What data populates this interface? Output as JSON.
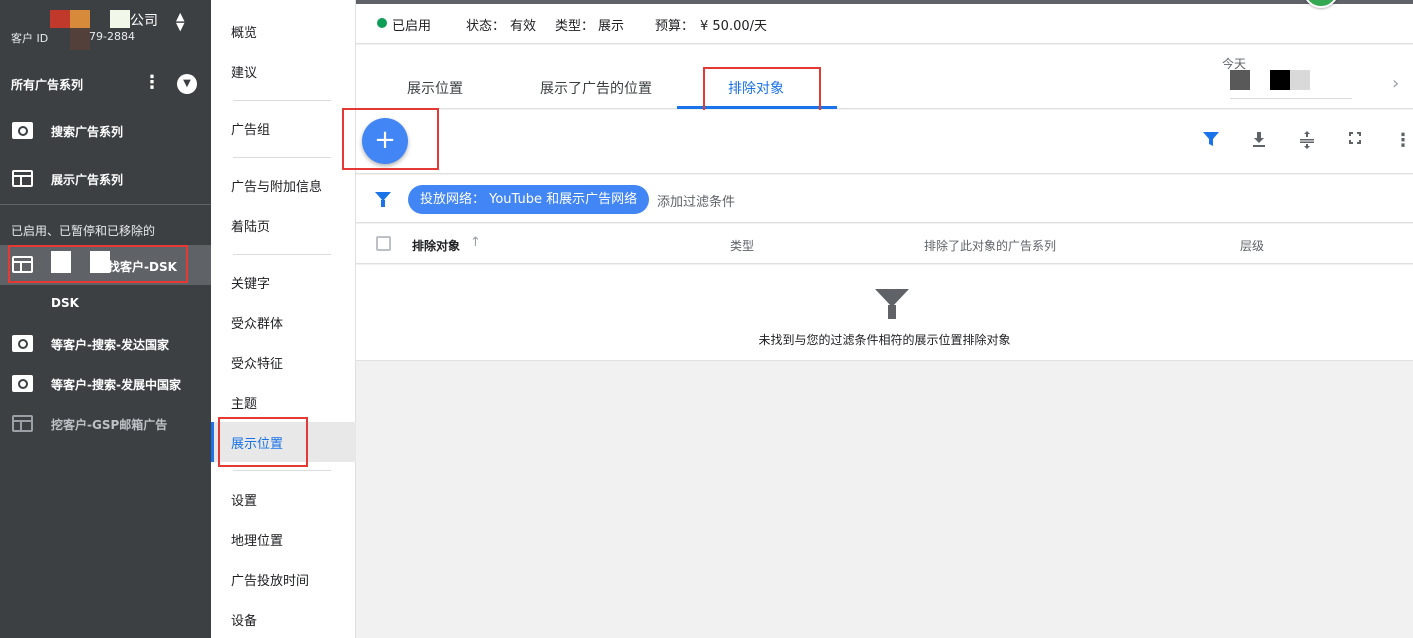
{
  "account": {
    "name_suffix": "公司",
    "customer_id_label": "客户 ID",
    "customer_id_partial": "79-2884"
  },
  "left_nav": {
    "all_campaigns": "所有广告系列",
    "search_campaigns": "搜索广告系列",
    "display_campaigns": "展示广告系列",
    "section_label": "已启用、已暂停和已移除的",
    "campaigns": [
      {
        "label": "找客户-DSK",
        "icon": "display-icon"
      },
      {
        "label": "DSK",
        "icon": ""
      },
      {
        "label": "等客户-搜索-发达国家",
        "icon": "search-icon"
      },
      {
        "label": "等客户-搜索-发展中国家",
        "icon": "search-icon"
      },
      {
        "label": "挖客户-GSP邮箱广告",
        "icon": "display-icon"
      }
    ]
  },
  "mid_nav": {
    "items": [
      "概览",
      "建议",
      "广告组",
      "广告与附加信息",
      "着陆页",
      "关键字",
      "受众群体",
      "受众特征",
      "主题",
      "展示位置",
      "设置",
      "地理位置",
      "广告投放时间",
      "设备"
    ],
    "active": "展示位置"
  },
  "status": {
    "enabled": "已启用",
    "state_label": "状态：",
    "state_value": "有效",
    "type_label": "类型：",
    "type_value": "展示",
    "budget_label": "预算：",
    "budget_value": "¥ 50.00/天"
  },
  "tabs": [
    {
      "label": "展示位置",
      "active": false
    },
    {
      "label": "展示了广告的位置",
      "active": false
    },
    {
      "label": "排除对象",
      "active": true
    }
  ],
  "date": {
    "label": "今天"
  },
  "toolbar": {
    "add": "+",
    "tools": [
      "filter-icon",
      "download-icon",
      "compact-icon",
      "fullscreen-icon",
      "more-icon"
    ]
  },
  "filter": {
    "chip": "投放网络： YouTube 和展示广告网络",
    "add": "添加过滤条件"
  },
  "table": {
    "columns": [
      "排除对象",
      "类型",
      "排除了此对象的广告系列",
      "层级"
    ],
    "empty_message": "未找到与您的过滤条件相符的展示位置排除对象"
  },
  "colors": {
    "accent": "#1a73e8",
    "sidebar": "#3c4043",
    "enabled_dot": "#0f9d58",
    "highlight_box": "#e53935"
  }
}
